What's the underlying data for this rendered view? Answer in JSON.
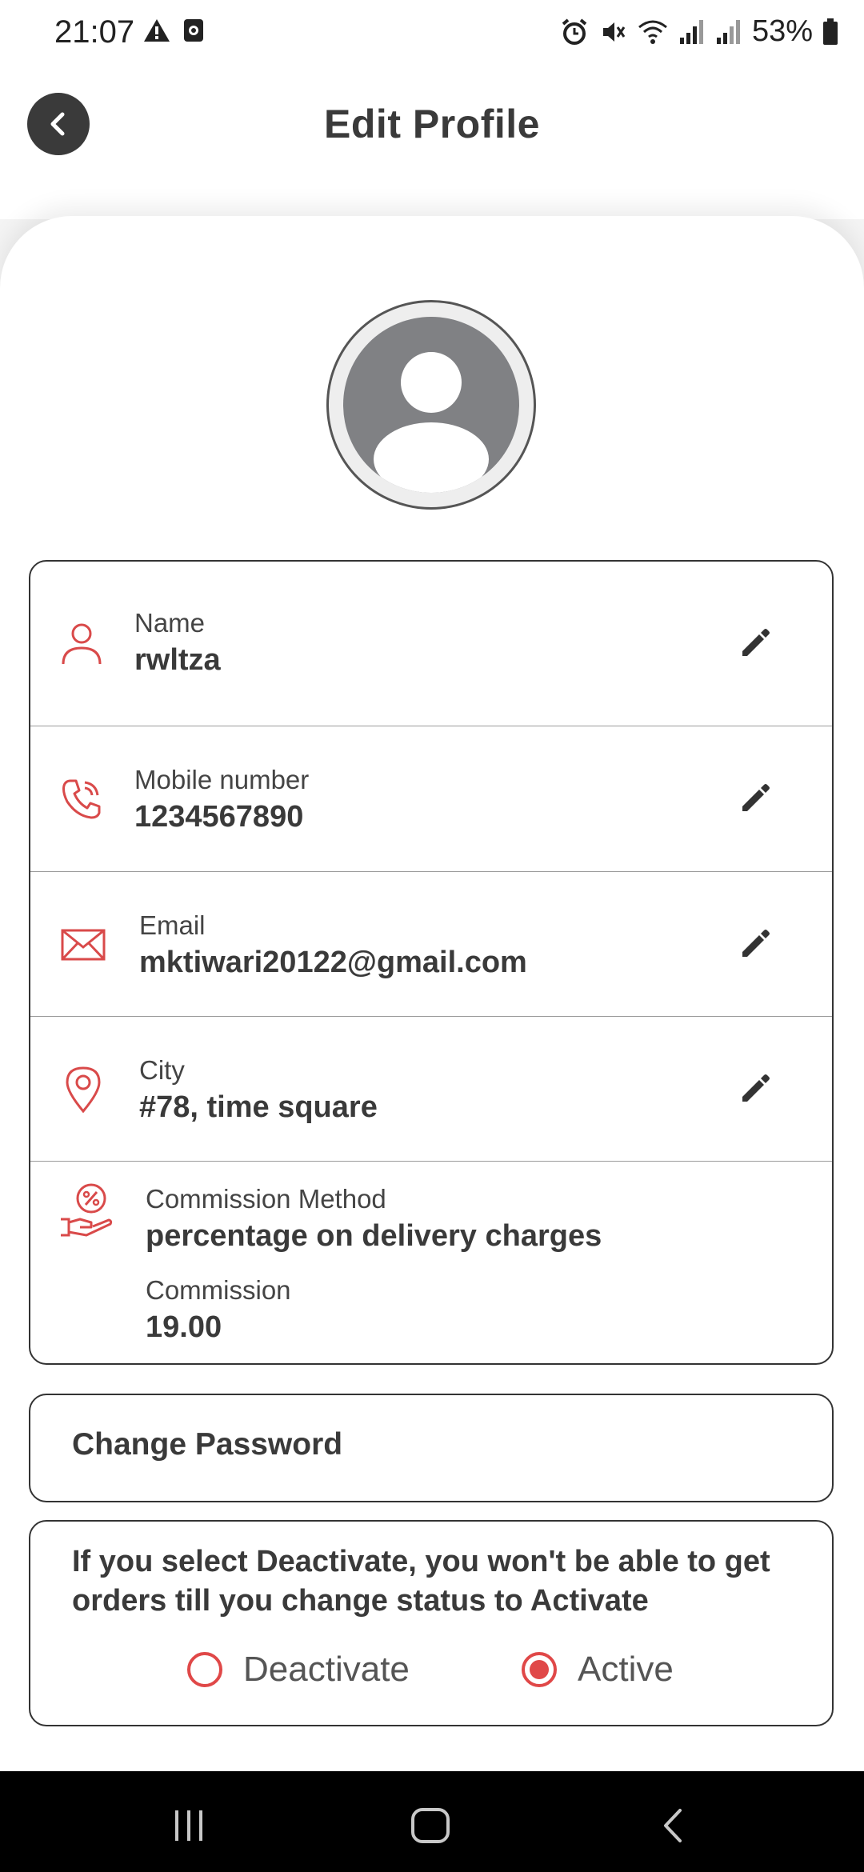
{
  "status_bar": {
    "time": "21:07",
    "battery": "53%",
    "icons_left": [
      "warning-icon",
      "screen-record-icon"
    ],
    "icons_right": [
      "alarm-icon",
      "mute-icon",
      "wifi-icon",
      "signal-icon",
      "signal-icon",
      "battery-icon"
    ]
  },
  "header": {
    "title": "Edit Profile",
    "back_icon": "back-arrow-icon"
  },
  "profile": {
    "avatar_icon": "user-avatar-icon",
    "fields": [
      {
        "label": "Name",
        "value": "rwltza",
        "icon": "person-icon",
        "editable": true
      },
      {
        "label": "Mobile number",
        "value": "1234567890",
        "icon": "phone-icon",
        "editable": true
      },
      {
        "label": "Email",
        "value": "mktiwari20122@gmail.com",
        "icon": "mail-icon",
        "editable": true
      },
      {
        "label": "City",
        "value": "#78, time square",
        "icon": "location-pin-icon",
        "editable": true
      }
    ],
    "commission": {
      "method_label": "Commission Method",
      "method_value": "percentage on delivery charges",
      "label": "Commission",
      "value": "19.00",
      "icon": "commission-hand-icon"
    }
  },
  "change_password": {
    "label": "Change Password"
  },
  "account_status": {
    "note": "If you select Deactivate, you won't be able to get orders till you change status to Activate",
    "options": [
      {
        "label": "Deactivate",
        "selected": false
      },
      {
        "label": "Active",
        "selected": true
      }
    ]
  },
  "colors": {
    "accent": "#e04848",
    "text": "#3a3a3a",
    "background": "#f4f4f4"
  },
  "nav_bar": {
    "buttons": [
      "recent-apps-icon",
      "home-icon",
      "back-icon"
    ]
  }
}
